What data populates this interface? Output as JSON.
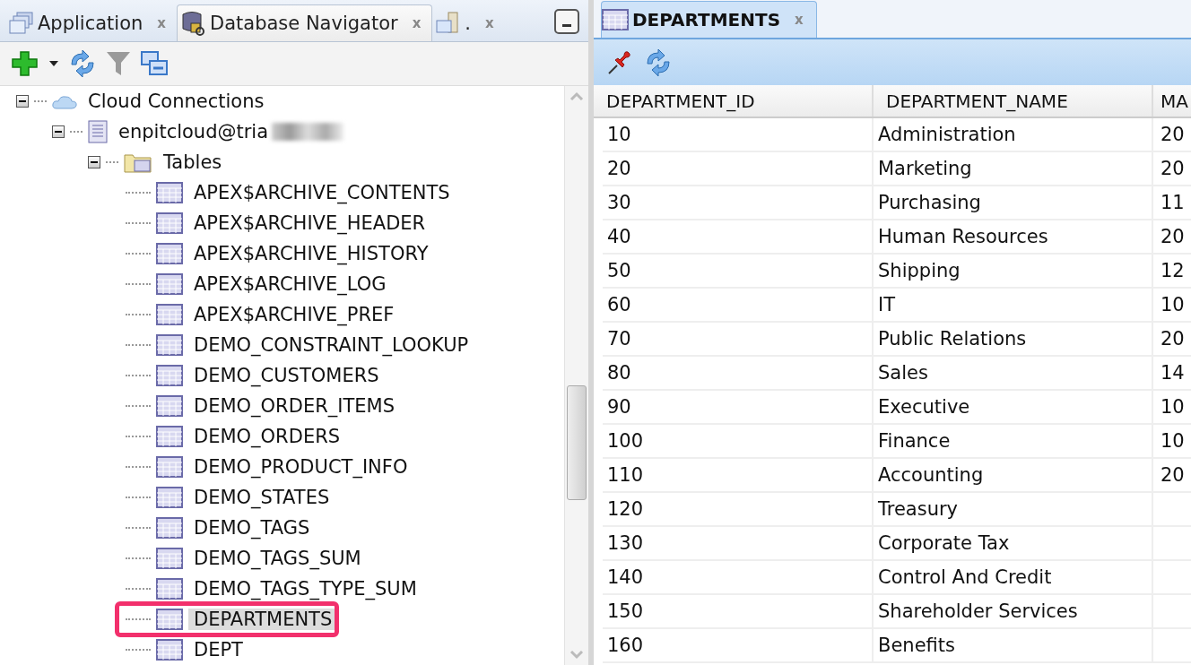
{
  "navigator": {
    "tabs": [
      {
        "label": "Application",
        "close": "x",
        "selected": false
      },
      {
        "label": "Database Navigator",
        "close": "x",
        "selected": true
      },
      {
        "label": ".",
        "close": "x",
        "selected": false
      }
    ],
    "tree": [
      {
        "label": "Cloud Connections",
        "kind": "cloud",
        "expanded": true,
        "selected": false,
        "children": [
          {
            "label": "enpitcloud@tria",
            "kind": "connection",
            "redacted": true,
            "expanded": true,
            "selected": false,
            "children": [
              {
                "label": "Tables",
                "kind": "folder",
                "expanded": true,
                "selected": false,
                "children": [
                  {
                    "label": "APEX$ARCHIVE_CONTENTS",
                    "kind": "table",
                    "selected": false
                  },
                  {
                    "label": "APEX$ARCHIVE_HEADER",
                    "kind": "table",
                    "selected": false
                  },
                  {
                    "label": "APEX$ARCHIVE_HISTORY",
                    "kind": "table",
                    "selected": false
                  },
                  {
                    "label": "APEX$ARCHIVE_LOG",
                    "kind": "table",
                    "selected": false
                  },
                  {
                    "label": "APEX$ARCHIVE_PREF",
                    "kind": "table",
                    "selected": false
                  },
                  {
                    "label": "DEMO_CONSTRAINT_LOOKUP",
                    "kind": "table",
                    "selected": false
                  },
                  {
                    "label": "DEMO_CUSTOMERS",
                    "kind": "table",
                    "selected": false
                  },
                  {
                    "label": "DEMO_ORDER_ITEMS",
                    "kind": "table",
                    "selected": false
                  },
                  {
                    "label": "DEMO_ORDERS",
                    "kind": "table",
                    "selected": false
                  },
                  {
                    "label": "DEMO_PRODUCT_INFO",
                    "kind": "table",
                    "selected": false
                  },
                  {
                    "label": "DEMO_STATES",
                    "kind": "table",
                    "selected": false
                  },
                  {
                    "label": "DEMO_TAGS",
                    "kind": "table",
                    "selected": false
                  },
                  {
                    "label": "DEMO_TAGS_SUM",
                    "kind": "table",
                    "selected": false
                  },
                  {
                    "label": "DEMO_TAGS_TYPE_SUM",
                    "kind": "table",
                    "selected": false
                  },
                  {
                    "label": "DEPARTMENTS",
                    "kind": "table",
                    "selected": true,
                    "highlighted": true
                  },
                  {
                    "label": "DEPT",
                    "kind": "table",
                    "selected": false
                  }
                ]
              }
            ]
          }
        ]
      }
    ]
  },
  "editor": {
    "tab": {
      "label": "DEPARTMENTS",
      "close": "x",
      "selected": true
    },
    "table": {
      "columns": [
        "DEPARTMENT_ID",
        "DEPARTMENT_NAME",
        "MA"
      ],
      "rows": [
        [
          "10",
          "Administration",
          "20"
        ],
        [
          "20",
          "Marketing",
          "20"
        ],
        [
          "30",
          "Purchasing",
          "11"
        ],
        [
          "40",
          "Human Resources",
          "20"
        ],
        [
          "50",
          "Shipping",
          "12"
        ],
        [
          "60",
          "IT",
          "10"
        ],
        [
          "70",
          "Public Relations",
          "20"
        ],
        [
          "80",
          "Sales",
          "14"
        ],
        [
          "90",
          "Executive",
          "10"
        ],
        [
          "100",
          "Finance",
          "10"
        ],
        [
          "110",
          "Accounting",
          "20"
        ],
        [
          "120",
          "Treasury",
          ""
        ],
        [
          "130",
          "Corporate Tax",
          ""
        ],
        [
          "140",
          "Control And Credit",
          ""
        ],
        [
          "150",
          "Shareholder Services",
          ""
        ],
        [
          "160",
          "Benefits",
          ""
        ]
      ]
    }
  }
}
